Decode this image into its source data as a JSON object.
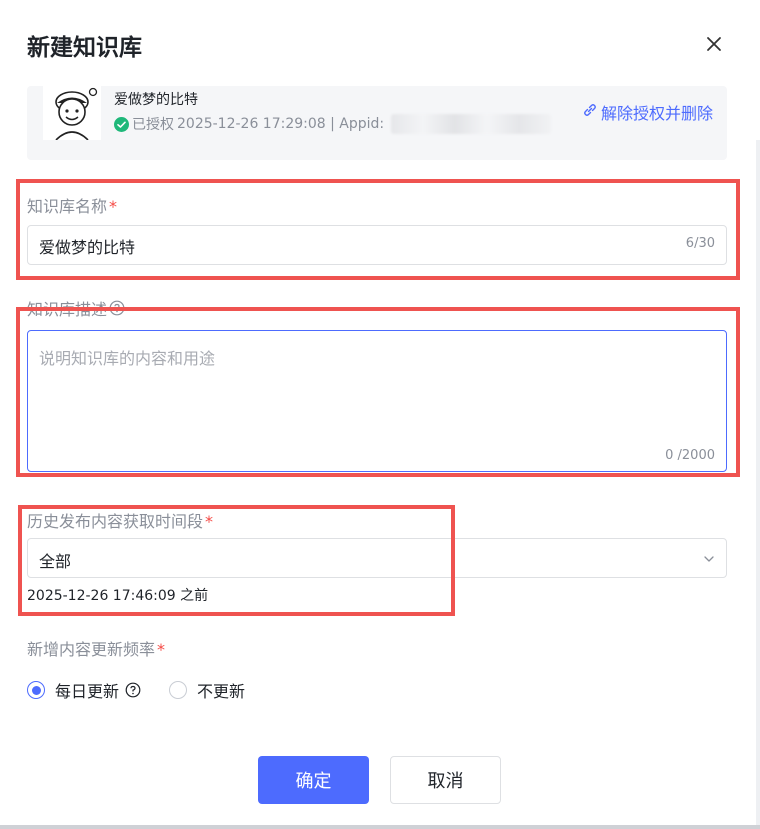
{
  "dialog": {
    "title": "新建知识库"
  },
  "account": {
    "name": "爱做梦的比特",
    "status": "已授权",
    "auth_info": "2025-12-26 17:29:08 | Appid:",
    "unbind_label": "解除授权并删除"
  },
  "form": {
    "name_label": "知识库名称",
    "name_value": "爱做梦的比特",
    "name_counter": "6/30",
    "desc_label": "知识库描述",
    "desc_placeholder": "说明知识库的内容和用途",
    "desc_counter": "0 /2000",
    "history_label": "历史发布内容获取时间段",
    "history_value": "全部",
    "history_hint": "2025-12-26 17:46:09 之前",
    "freq_label": "新增内容更新频率",
    "freq_options": [
      {
        "label": "每日更新",
        "selected": true
      },
      {
        "label": "不更新",
        "selected": false
      }
    ],
    "required_mark": "*"
  },
  "buttons": {
    "confirm": "确定",
    "cancel": "取消"
  },
  "colors": {
    "accent": "#4d6bfe",
    "required": "#f54a45",
    "highlight": "#ef5350",
    "verified": "#1fb87a"
  }
}
